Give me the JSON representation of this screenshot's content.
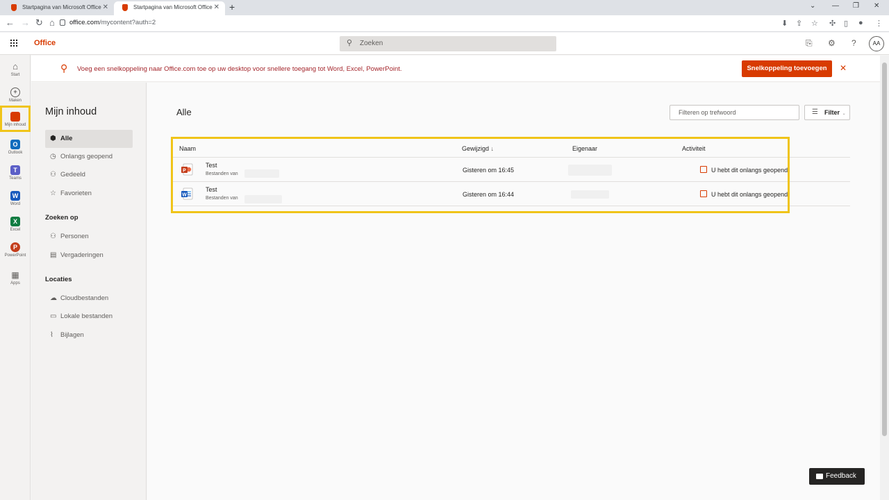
{
  "browser": {
    "tabs": [
      {
        "title": "Startpagina van Microsoft Office",
        "active": false
      },
      {
        "title": "Startpagina van Microsoft Office",
        "active": true
      }
    ],
    "url_host": "office.com",
    "url_path": "/mycontent?auth=2"
  },
  "header": {
    "brand": "Office",
    "search_placeholder": "Zoeken",
    "avatar_initials": "AA"
  },
  "rail": [
    {
      "label": "Start",
      "icon": "home-icon",
      "color": "#605e5c"
    },
    {
      "label": "Maken",
      "icon": "plus-icon",
      "color": "#605e5c"
    },
    {
      "label": "Mijn inhoud",
      "icon": "folder-icon",
      "color": "#d83b01"
    },
    {
      "label": "Outlook",
      "icon": "outlook-icon",
      "color": "#0f6cbd"
    },
    {
      "label": "Teams",
      "icon": "teams-icon",
      "color": "#5b5fc7"
    },
    {
      "label": "Word",
      "icon": "word-icon",
      "color": "#185abd"
    },
    {
      "label": "Excel",
      "icon": "excel-icon",
      "color": "#107c41"
    },
    {
      "label": "PowerPoint",
      "icon": "powerpoint-icon",
      "color": "#c43e1c"
    },
    {
      "label": "Apps",
      "icon": "apps-icon",
      "color": "#605e5c"
    }
  ],
  "banner": {
    "message": "Voeg een snelkoppeling naar Office.com toe op uw desktop voor snellere toegang tot Word, Excel, PowerPoint.",
    "cta": "Snelkoppeling toevoegen"
  },
  "leftnav": {
    "title": "Mijn inhoud",
    "items": [
      {
        "label": "Alle"
      },
      {
        "label": "Onlangs geopend"
      },
      {
        "label": "Gedeeld"
      },
      {
        "label": "Favorieten"
      }
    ],
    "section_search": "Zoeken op",
    "search_items": [
      {
        "label": "Personen"
      },
      {
        "label": "Vergaderingen"
      }
    ],
    "section_locations": "Locaties",
    "location_items": [
      {
        "label": "Cloudbestanden"
      },
      {
        "label": "Lokale bestanden"
      },
      {
        "label": "Bijlagen"
      }
    ]
  },
  "main": {
    "title": "Alle",
    "filter_placeholder": "Filteren op trefwoord",
    "filter_button": "Filter",
    "columns": {
      "name": "Naam",
      "modified": "Gewijzigd",
      "owner": "Eigenaar",
      "activity": "Activiteit"
    },
    "files": [
      {
        "type": "powerpoint",
        "name": "Test",
        "location": "Bestanden van",
        "modified": "Gisteren om 16:45",
        "activity": "U hebt dit onlangs geopend"
      },
      {
        "type": "word",
        "name": "Test",
        "location": "Bestanden van",
        "modified": "Gisteren om 16:44",
        "activity": "U hebt dit onlangs geopend"
      }
    ]
  },
  "feedback": "Feedback",
  "colors": {
    "accent": "#d83b01",
    "highlight": "#f0c419"
  }
}
